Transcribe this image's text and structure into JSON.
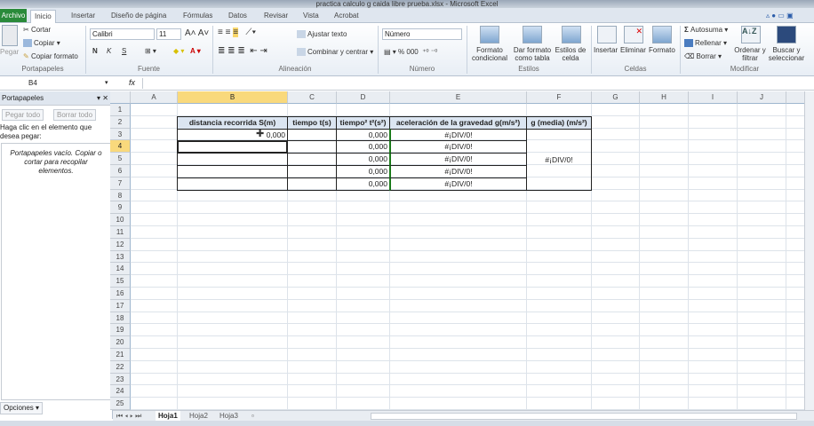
{
  "window": {
    "title": "practica calculo g caida libre prueba.xlsx - Microsoft Excel"
  },
  "tabs": [
    {
      "label": "Archivo"
    },
    {
      "label": "Inicio"
    },
    {
      "label": "Insertar"
    },
    {
      "label": "Diseño de página"
    },
    {
      "label": "Fórmulas"
    },
    {
      "label": "Datos"
    },
    {
      "label": "Revisar"
    },
    {
      "label": "Vista"
    },
    {
      "label": "Acrobat"
    }
  ],
  "ribbon": {
    "portapapeles": {
      "label": "Portapapeles",
      "pegar": "Pegar",
      "cortar": "Cortar",
      "copiar": "Copiar",
      "copiar_formato": "Copiar formato"
    },
    "fuente": {
      "label": "Fuente",
      "font": "Calibri",
      "size": "11",
      "bold": "N",
      "italic": "K",
      "underline": "S"
    },
    "alineacion": {
      "label": "Alineación",
      "ajustar": "Ajustar texto",
      "combinar": "Combinar y centrar"
    },
    "numero": {
      "label": "Número",
      "format": "Número",
      "percent": "%",
      "thousands": "000"
    },
    "estilos": {
      "label": "Estilos",
      "formato_cond": "Formato condicional",
      "dar_formato": "Dar formato como tabla",
      "estilos_celda": "Estilos de celda"
    },
    "celdas": {
      "label": "Celdas",
      "insertar": "Insertar",
      "eliminar": "Eliminar",
      "formato": "Formato"
    },
    "modificar": {
      "label": "Modificar",
      "autosuma": "Autosuma",
      "rellenar": "Rellenar",
      "borrar": "Borrar",
      "ordenar": "Ordenar y filtrar",
      "buscar": "Buscar y seleccionar"
    }
  },
  "formula_bar": {
    "name_box": "B4",
    "fx": "fx",
    "value": ""
  },
  "clipboard_pane": {
    "title": "Portapapeles",
    "pegar_todo": "Pegar todo",
    "borrar_todo": "Borrar todo",
    "instruction": "Haga clic en el elemento que desea pegar:",
    "empty_msg": "Portapapeles vacío. Copiar o cortar para recopilar elementos.",
    "opciones": "Opciones"
  },
  "sheet": {
    "columns": [
      "A",
      "B",
      "C",
      "D",
      "E",
      "F",
      "G",
      "H",
      "I",
      "J"
    ],
    "selected_column": "B",
    "selected_row": 4,
    "row_count": 25,
    "headers": [
      "distancia recorrida S(m)",
      "tiempo t(s)",
      "tiempo² t²(s²)",
      "aceleración de la gravedad g(m/s²)",
      "g (media) (m/s²)"
    ],
    "rows": [
      {
        "b": "0,000",
        "c": "",
        "d": "0,000",
        "e": "#¡DIV/0!"
      },
      {
        "b": "",
        "c": "",
        "d": "0,000",
        "e": "#¡DIV/0!"
      },
      {
        "b": "",
        "c": "",
        "d": "0,000",
        "e": "#¡DIV/0!"
      },
      {
        "b": "",
        "c": "",
        "d": "0,000",
        "e": "#¡DIV/0!"
      },
      {
        "b": "",
        "c": "",
        "d": "0,000",
        "e": "#¡DIV/0!"
      }
    ],
    "g_media": "#¡DIV/0!"
  },
  "sheet_tabs": [
    {
      "label": "Hoja1",
      "active": true
    },
    {
      "label": "Hoja2"
    },
    {
      "label": "Hoja3"
    }
  ]
}
